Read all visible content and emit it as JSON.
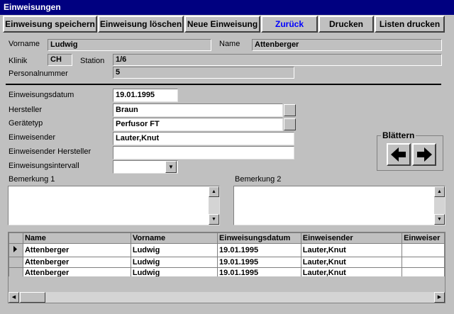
{
  "window": {
    "title": "Einweisungen"
  },
  "toolbar": {
    "save": "Einweisung speichern",
    "delete": "Einweisung löschen",
    "new": "Neue Einweisung",
    "back": "Zurück",
    "print": "Drucken",
    "print_lists": "Listen drucken"
  },
  "person": {
    "vorname_label": "Vorname",
    "vorname": "Ludwig",
    "name_label": "Name",
    "name": "Attenberger",
    "klinik_label": "Klinik",
    "klinik": "CH",
    "station_label": "Station",
    "station": "1/6",
    "personalnummer_label": "Personalnummer",
    "personalnummer": "5"
  },
  "form": {
    "datum_label": "Einweisungsdatum",
    "datum": "19.01.1995",
    "hersteller_label": "Hersteller",
    "hersteller": "Braun",
    "geraetetyp_label": "Gerätetyp",
    "geraetetyp": "Perfusor FT",
    "einweisender_label": "Einweisender",
    "einweisender": "Lauter,Knut",
    "einweisender_hersteller_label": "Einweisender Hersteller",
    "einweisender_hersteller": "",
    "intervall_label": "Einweisungsintervall",
    "intervall": ""
  },
  "blaettern": {
    "label": "Blättern"
  },
  "remarks": {
    "bemerkung1_label": "Bemerkung 1",
    "bemerkung1": "",
    "bemerkung2_label": "Bemerkung 2",
    "bemerkung2": ""
  },
  "grid": {
    "columns": [
      "Name",
      "Vorname",
      "Einweisungsdatum",
      "Einweisender",
      "Einweiser"
    ],
    "rows": [
      [
        "Attenberger",
        "Ludwig",
        "19.01.1995",
        "Lauter,Knut",
        ""
      ],
      [
        "Attenberger",
        "Ludwig",
        "19.01.1995",
        "Lauter,Knut",
        ""
      ],
      [
        "Attenberger",
        "Ludwig",
        "19.01.1995",
        "Lauter,Knut",
        ""
      ]
    ]
  },
  "icons": {
    "prev": "arrow-left-icon",
    "next": "arrow-right-icon",
    "dropdown": "chevron-down-icon",
    "row_pointer": "row-pointer-icon"
  },
  "colors": {
    "titlebar": "#000080",
    "back_button_text": "#0000ff",
    "face": "#c0c0c0"
  }
}
